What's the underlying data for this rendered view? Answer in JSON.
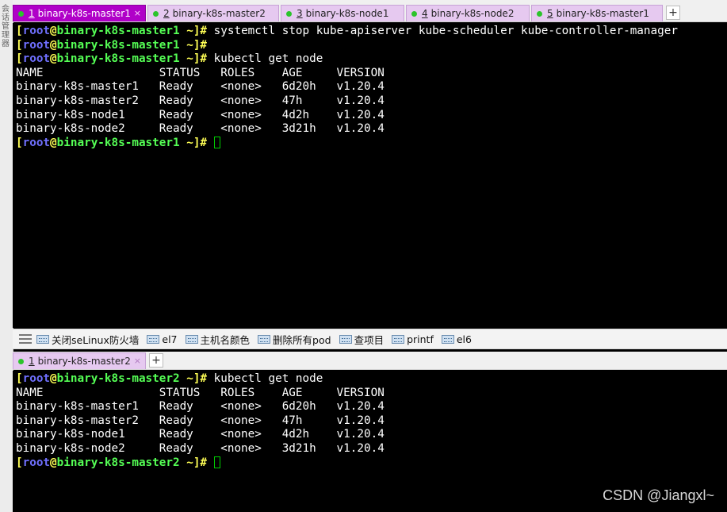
{
  "sidebar": {
    "text": "会话管理器"
  },
  "top_tabs": [
    {
      "num": "1",
      "label": "binary-k8s-master1",
      "active": true
    },
    {
      "num": "2",
      "label": "binary-k8s-master2",
      "active": false
    },
    {
      "num": "3",
      "label": "binary-k8s-node1",
      "active": false
    },
    {
      "num": "4",
      "label": "binary-k8s-node2",
      "active": false
    },
    {
      "num": "5",
      "label": "binary-k8s-master1",
      "active": false
    }
  ],
  "new_tab_symbol": "+",
  "close_symbol": "×",
  "top_terminal": {
    "prompt_open": "[",
    "user": "root",
    "at": "@",
    "host": "binary-k8s-master1",
    "dir": " ~",
    "prompt_close": "]#",
    "cmd1": " systemctl stop kube-apiserver kube-scheduler kube-controller-manager",
    "cmd3": " kubectl get node",
    "output": [
      "NAME                 STATUS   ROLES    AGE     VERSION",
      "binary-k8s-master1   Ready    <none>   6d20h   v1.20.4",
      "binary-k8s-master2   Ready    <none>   47h     v1.20.4",
      "binary-k8s-node1     Ready    <none>   4d2h    v1.20.4",
      "binary-k8s-node2     Ready    <none>   3d21h   v1.20.4"
    ]
  },
  "quick_buttons": [
    "关闭seLinux防火墙",
    "el7",
    "主机名颜色",
    "删除所有pod",
    "查项目",
    "printf",
    "el6"
  ],
  "bottom_tab": {
    "num": "1",
    "label": "binary-k8s-master2"
  },
  "bottom_terminal": {
    "host": "binary-k8s-master2",
    "cmd1": " kubectl get node",
    "output": [
      "NAME                 STATUS   ROLES    AGE     VERSION",
      "binary-k8s-master1   Ready    <none>   6d20h   v1.20.4",
      "binary-k8s-master2   Ready    <none>   47h     v1.20.4",
      "binary-k8s-node1     Ready    <none>   4d2h    v1.20.4",
      "binary-k8s-node2     Ready    <none>   3d21h   v1.20.4"
    ]
  },
  "watermark": "CSDN @Jiangxl~",
  "colors": {
    "active_tab": "#b000c8",
    "inactive_tab": "#e6c9f0",
    "prompt_bracket": "#ffff55",
    "prompt_user": "#7070ff",
    "prompt_host": "#55ff55",
    "cursor": "#00d000"
  }
}
